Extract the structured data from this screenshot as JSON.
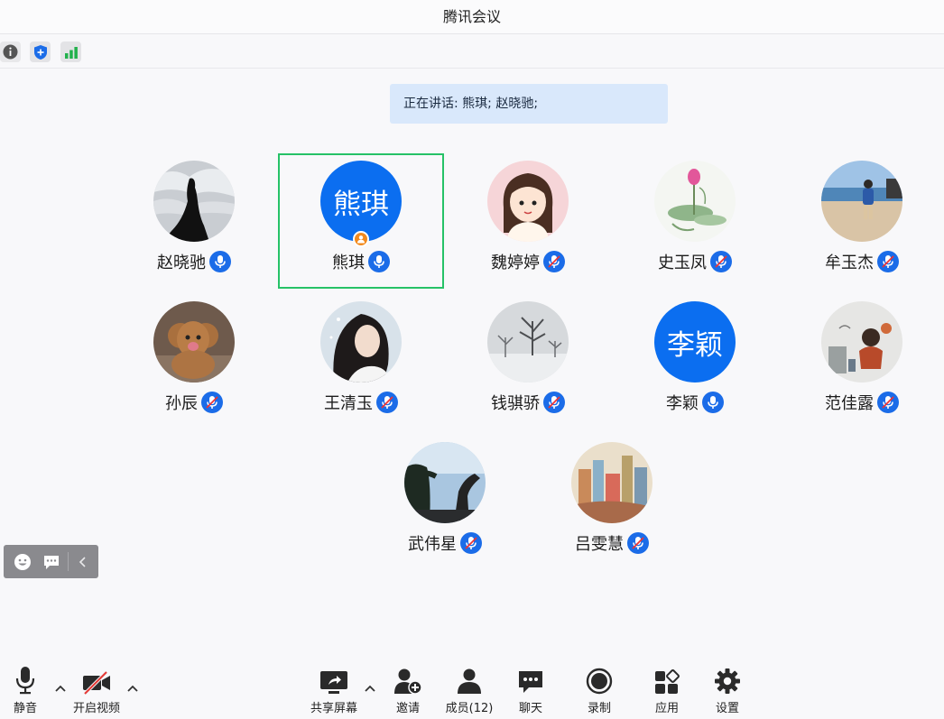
{
  "app": {
    "title": "腾讯会议"
  },
  "status_icons": [
    {
      "name": "info-icon"
    },
    {
      "name": "shield-icon"
    },
    {
      "name": "signal-icon"
    }
  ],
  "speaking": {
    "text": "正在讲话: 熊琪; 赵晓驰;"
  },
  "participants": [
    {
      "name": "赵晓驰",
      "avatar": "photo",
      "mic": "on"
    },
    {
      "name": "熊琪",
      "avatar": "text",
      "avatar_text": "熊琪",
      "mic": "on",
      "host": true,
      "active": true
    },
    {
      "name": "魏婷婷",
      "avatar": "photo",
      "mic": "muted"
    },
    {
      "name": "史玉凤",
      "avatar": "photo",
      "mic": "muted"
    },
    {
      "name": "牟玉杰",
      "avatar": "photo",
      "mic": "muted"
    },
    {
      "name": "孙辰",
      "avatar": "photo",
      "mic": "muted"
    },
    {
      "name": "王清玉",
      "avatar": "photo",
      "mic": "muted"
    },
    {
      "name": "钱骐骄",
      "avatar": "photo",
      "mic": "muted"
    },
    {
      "name": "李颖",
      "avatar": "text",
      "avatar_text": "李颖",
      "mic": "on"
    },
    {
      "name": "范佳露",
      "avatar": "photo",
      "mic": "muted"
    },
    {
      "name": "武伟星",
      "avatar": "photo",
      "mic": "muted"
    },
    {
      "name": "吕雯慧",
      "avatar": "photo",
      "mic": "muted"
    }
  ],
  "toolbar": {
    "mute": "静音",
    "video": "开启视频",
    "share": "共享屏幕",
    "invite": "邀请",
    "members": "成员(12)",
    "chat": "聊天",
    "record": "录制",
    "apps": "应用",
    "settings": "设置"
  },
  "colors": {
    "accent": "#0b6ef0",
    "active_border": "#26c267",
    "host_badge": "#f28a1e",
    "speaking_bg": "#d9e8fb"
  }
}
